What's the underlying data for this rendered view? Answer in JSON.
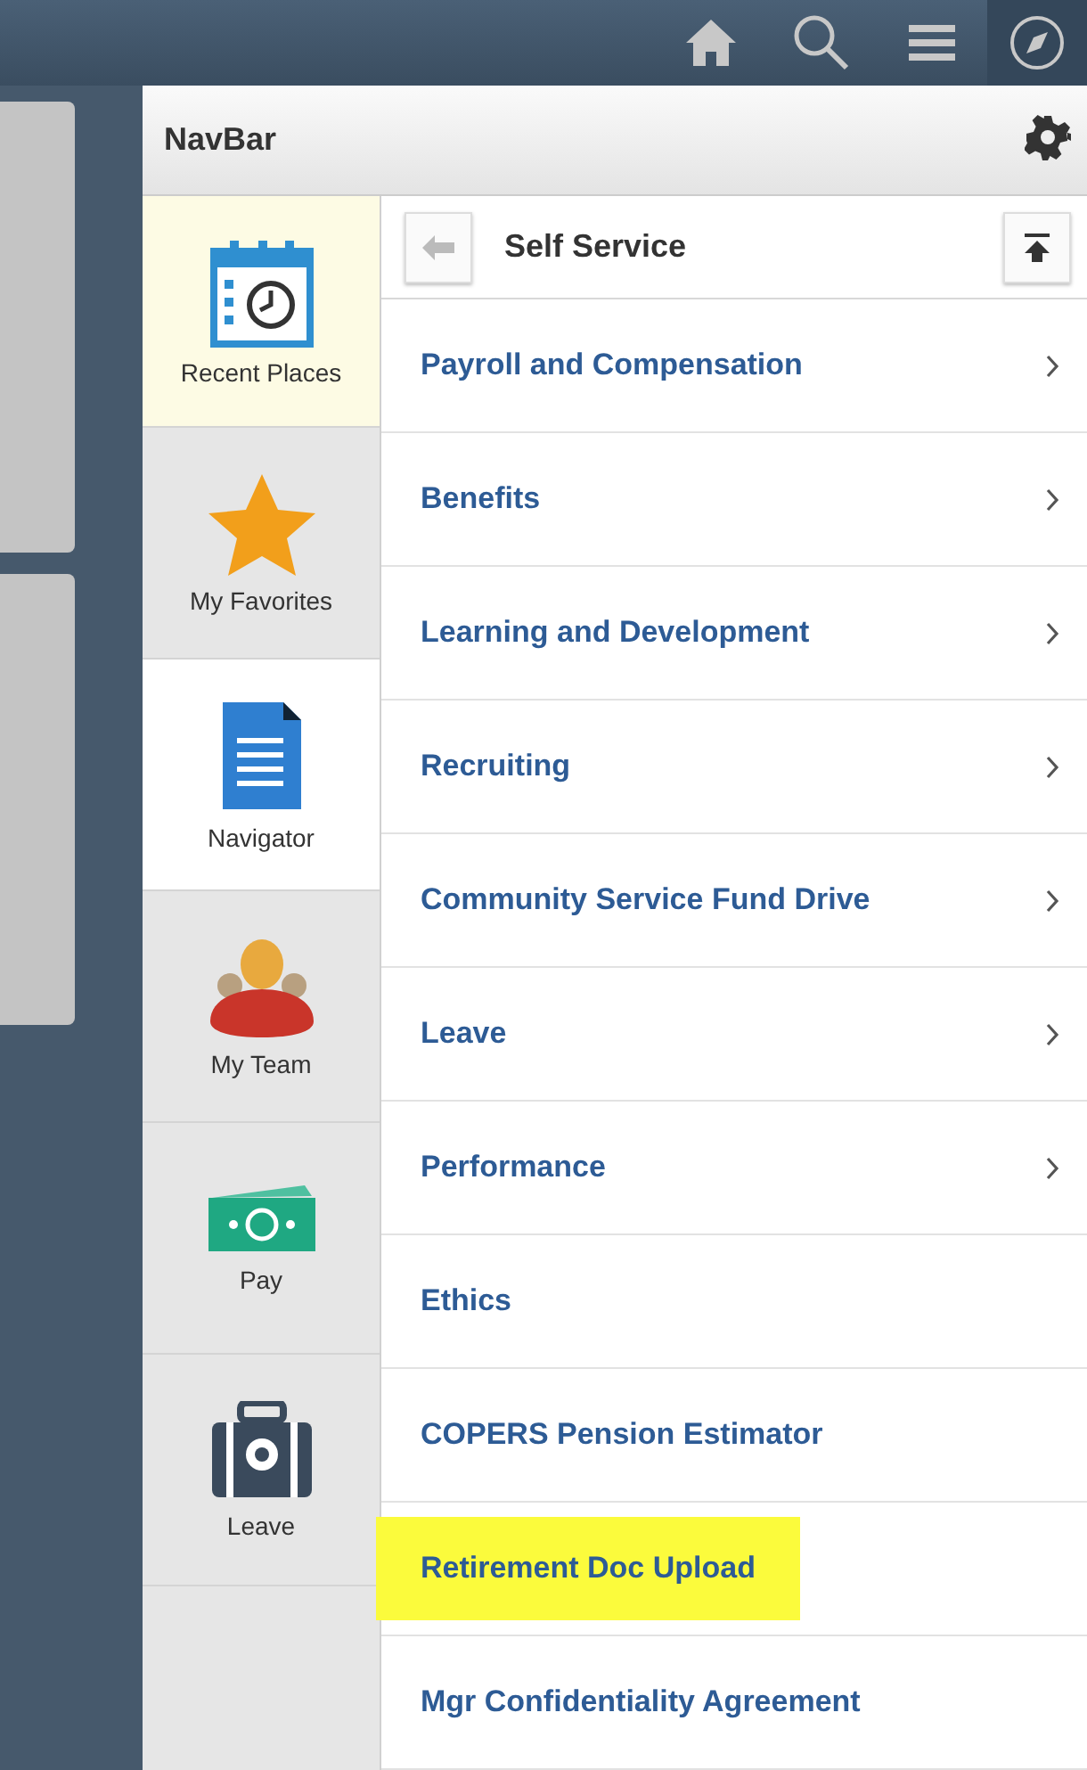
{
  "navbar": {
    "title": "NavBar"
  },
  "tiles": [
    {
      "label": "Recent Places",
      "kind": "calendar",
      "selected": false,
      "hovered": true
    },
    {
      "label": "My Favorites",
      "kind": "star",
      "selected": false,
      "hovered": false
    },
    {
      "label": "Navigator",
      "kind": "document",
      "selected": true,
      "hovered": false
    },
    {
      "label": "My Team",
      "kind": "team",
      "selected": false,
      "hovered": false
    },
    {
      "label": "Pay",
      "kind": "money",
      "selected": false,
      "hovered": false
    },
    {
      "label": "Leave",
      "kind": "suitcase",
      "selected": false,
      "hovered": false
    }
  ],
  "navigator": {
    "title": "Self Service",
    "items": [
      {
        "label": "Payroll and Compensation",
        "expandable": true,
        "highlighted": false
      },
      {
        "label": "Benefits",
        "expandable": true,
        "highlighted": false
      },
      {
        "label": "Learning and Development",
        "expandable": true,
        "highlighted": false
      },
      {
        "label": "Recruiting",
        "expandable": true,
        "highlighted": false
      },
      {
        "label": "Community Service Fund Drive",
        "expandable": true,
        "highlighted": false
      },
      {
        "label": "Leave",
        "expandable": true,
        "highlighted": false
      },
      {
        "label": "Performance",
        "expandable": true,
        "highlighted": false
      },
      {
        "label": "Ethics",
        "expandable": false,
        "highlighted": false
      },
      {
        "label": "COPERS Pension Estimator",
        "expandable": false,
        "highlighted": false
      },
      {
        "label": "Retirement Doc Upload",
        "expandable": false,
        "highlighted": true
      },
      {
        "label": "Mgr Confidentiality Agreement",
        "expandable": false,
        "highlighted": false
      }
    ]
  }
}
